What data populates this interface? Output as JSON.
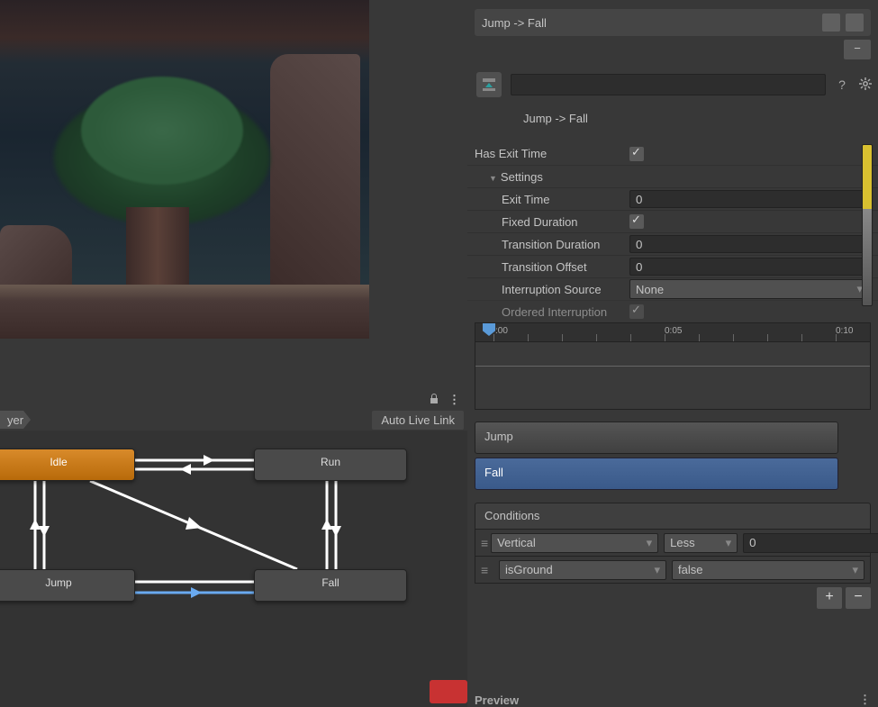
{
  "inspector": {
    "title": "Jump -> Fall",
    "transition_name": "Jump -> Fall",
    "has_exit_time_label": "Has Exit Time",
    "has_exit_time": true,
    "settings_label": "Settings",
    "exit_time_label": "Exit Time",
    "exit_time": "0",
    "fixed_duration_label": "Fixed Duration",
    "fixed_duration": true,
    "transition_duration_label": "Transition Duration",
    "transition_duration": "0",
    "transition_offset_label": "Transition Offset",
    "transition_offset": "0",
    "interruption_source_label": "Interruption Source",
    "interruption_source": "None",
    "ordered_interruption_label": "Ordered Interruption",
    "ordered_interruption": true
  },
  "timeline": {
    "t0": ":00",
    "t1": "0:05",
    "t2": "0:10",
    "clip_a": "Jump",
    "clip_b": "Fall"
  },
  "conditions": {
    "header": "Conditions",
    "rows": [
      {
        "param": "Vertical",
        "op": "Less",
        "value": "0"
      },
      {
        "param": "isGround",
        "op": "false"
      }
    ]
  },
  "animator": {
    "breadcrumb": "yer",
    "auto_live_link": "Auto Live Link",
    "states": {
      "idle": "Idle",
      "run": "Run",
      "jump": "Jump",
      "fall": "Fall"
    }
  },
  "preview_label": "Preview",
  "minus": "−",
  "plus": "+"
}
